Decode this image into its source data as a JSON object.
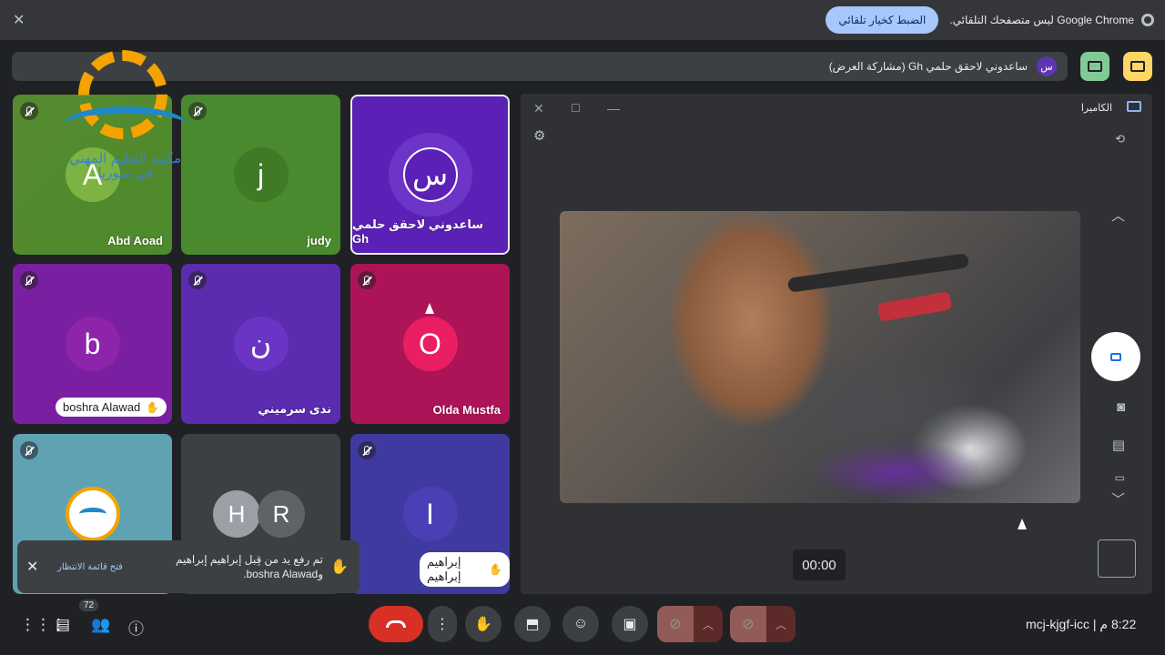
{
  "infobar": {
    "message": "Google Chrome ليس متصفحك التلقائي.",
    "set_default_button": "الضبط كخيار تلقائي"
  },
  "presenter_bar": {
    "avatar_letter": "س",
    "text": "ساعدوني لاحقق حلمي Gh (مشاركة العرض)"
  },
  "watermark": {
    "logo_text_line1": "مكتبة التعليم المهني",
    "logo_text_line2": "في سوريا"
  },
  "tiles": [
    {
      "name": "Abd Aoad",
      "avatar": "A",
      "color": "#4e8a2b",
      "muted": true
    },
    {
      "name": "judy",
      "avatar": "j",
      "color": "#4a8a2e",
      "muted": true
    },
    {
      "name": "ساعدوني لاحقق حلمي Gh",
      "avatar": "س",
      "color": "#5b21b6",
      "muted": false,
      "active_speaker_frame": true
    },
    {
      "name": "boshra Alawad",
      "avatar": "b",
      "color": "#7b1fa2",
      "muted": true,
      "hand_raised": true
    },
    {
      "name": "ندى سرميني",
      "avatar": "ن",
      "color": "#5b2bb0",
      "muted": true
    },
    {
      "name": "Olda Mustfa",
      "avatar": "O",
      "color": "#ad1457",
      "muted": true
    },
    {
      "name": "",
      "avatar": "",
      "color": "#5fa3b3",
      "muted": true,
      "logo_avatar": true
    },
    {
      "name": "",
      "avatar_h": "H",
      "avatar_r": "R",
      "color": "#3c4043"
    },
    {
      "name": "إبراهيم إبراهيم",
      "avatar": "I",
      "color": "#3f3aa0",
      "muted": true,
      "hand_raised": true
    }
  ],
  "toast": {
    "message": "تم رفع يد من قِبل إبراهيم إبراهيم وboshra Alawad.",
    "open_queue": "فتح قائمة الانتظار"
  },
  "camera_panel": {
    "title": "الكاميرا",
    "timer": "00:00"
  },
  "bottom_bar": {
    "meeting_code": "mcj-kjgf-icc",
    "time": "8:22 م",
    "chat_badge": "72"
  },
  "colors": {
    "background": "#202124",
    "hangup": "#d93025",
    "accent": "#a8c7fa"
  }
}
